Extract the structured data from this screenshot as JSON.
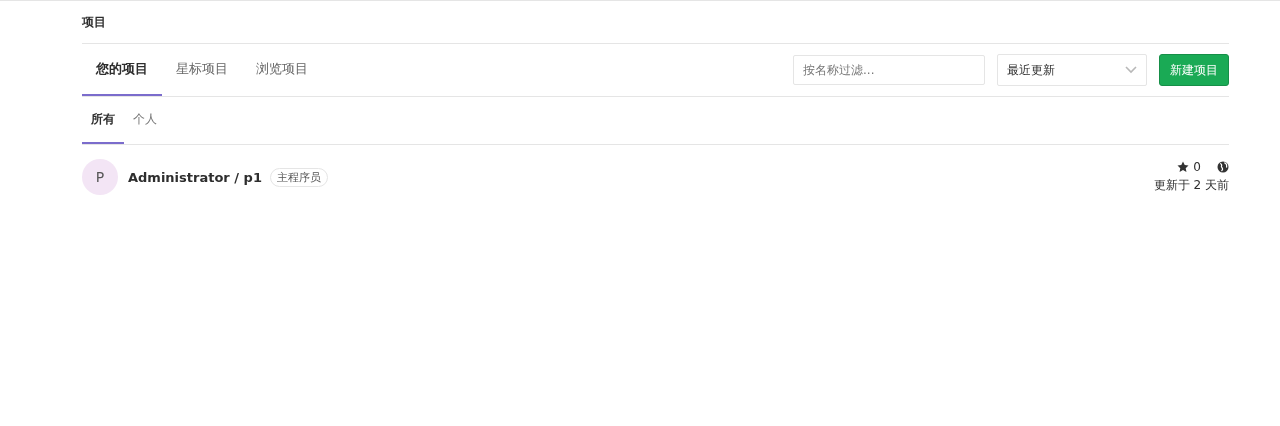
{
  "breadcrumb": "项目",
  "tabs": [
    {
      "label": "您的项目",
      "selected": true
    },
    {
      "label": "星标项目",
      "selected": false
    },
    {
      "label": "浏览项目",
      "selected": false
    }
  ],
  "filter": {
    "placeholder": "按名称过滤..."
  },
  "sort": {
    "value": "最近更新"
  },
  "new_button": "新建项目",
  "subtabs": [
    {
      "label": "所有",
      "selected": true
    },
    {
      "label": "个人",
      "selected": false
    }
  ],
  "projects": [
    {
      "avatar": "P",
      "name": "Administrator / p1",
      "role": "主程序员",
      "stars": "0",
      "updated": "更新于 2 天前"
    }
  ]
}
